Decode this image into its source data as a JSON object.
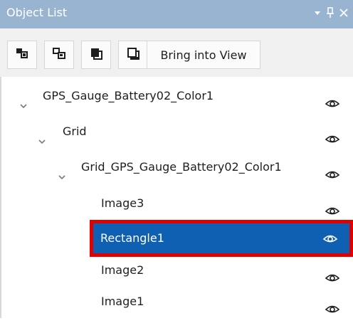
{
  "panel": {
    "title": "Object List",
    "icons": [
      "dropdown-arrow-icon",
      "pin-icon",
      "close-icon"
    ]
  },
  "toolbar": {
    "buttons": [
      {
        "icon": "bring-forward-icon"
      },
      {
        "icon": "send-backward-icon"
      },
      {
        "icon": "bring-to-front-icon"
      },
      {
        "icon": "send-to-back-icon"
      }
    ],
    "bring_into_view_label": "Bring into View"
  },
  "tree": {
    "items": [
      {
        "label": "GPS_Gauge_Battery02_Color1",
        "expanded": true,
        "level": 0
      },
      {
        "label": "Grid",
        "expanded": true,
        "level": 1
      },
      {
        "label": "Grid_GPS_Gauge_Battery02_Color1",
        "expanded": true,
        "level": 2
      },
      {
        "label": "Image3",
        "level": 3
      },
      {
        "label": "Rectangle1",
        "level": 3,
        "selected": true
      },
      {
        "label": "Image2",
        "level": 3
      },
      {
        "label": "Image1",
        "level": 3
      }
    ]
  },
  "colors": {
    "title_bar": "#99b4d1",
    "selection": "#0f5fb2",
    "highlight_border": "#e10000"
  }
}
